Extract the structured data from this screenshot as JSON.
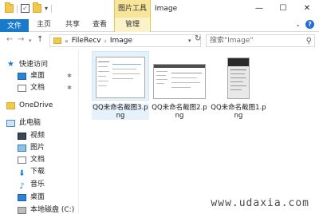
{
  "titlebar": {
    "context_tab": "图片工具",
    "title": "Image",
    "minimize": "—",
    "maximize": "☐",
    "close": "✕"
  },
  "ribbon": {
    "tabs": [
      "文件",
      "主页",
      "共享",
      "查看",
      "管理"
    ]
  },
  "address": {
    "back": "←",
    "forward": "→",
    "up": "↑",
    "overflow": "«",
    "crumbs": [
      "FileRecv",
      "Image"
    ],
    "search_placeholder": "搜索\"Image\""
  },
  "nav": {
    "quick_access": "快速访问",
    "quick_items": [
      "桌面",
      "文档"
    ],
    "onedrive": "OneDrive",
    "this_pc": "此电脑",
    "pc_items": [
      "视频",
      "图片",
      "文档",
      "下载",
      "音乐",
      "桌面",
      "本地磁盘 (C:)"
    ]
  },
  "files": [
    {
      "name": "QQ未命名截图3.png",
      "selected": true
    },
    {
      "name": "QQ未命名截图2.png",
      "selected": false
    },
    {
      "name": "QQ未命名截图1.png",
      "selected": false
    }
  ],
  "watermark": "www.udaxia.com"
}
